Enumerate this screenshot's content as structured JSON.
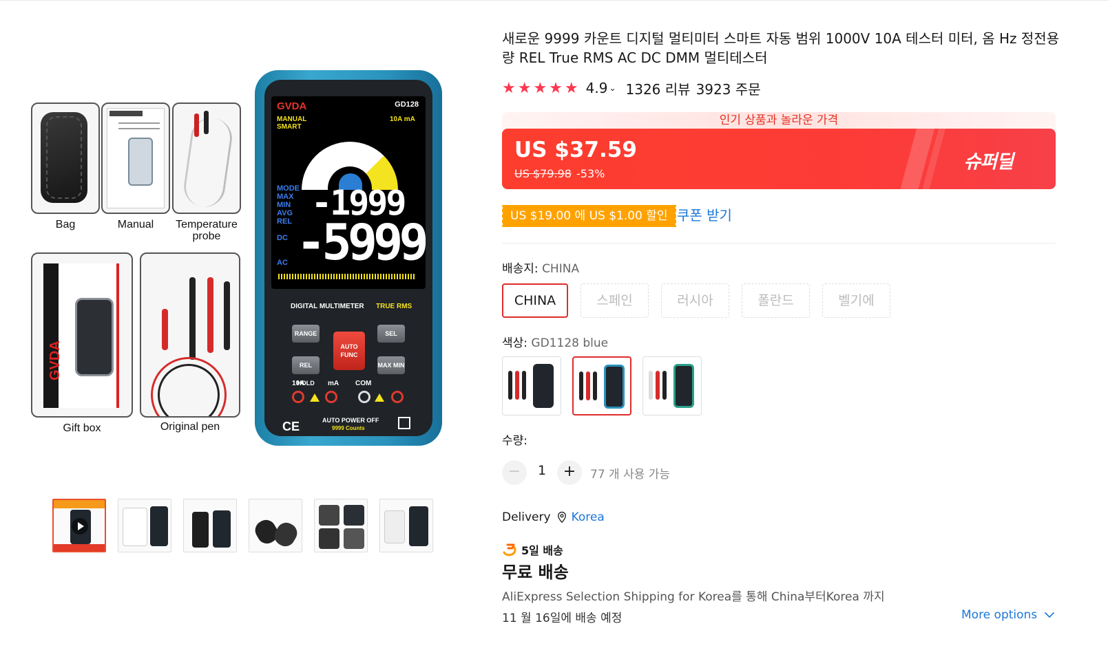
{
  "gallery": {
    "accessories": [
      {
        "label": "Bag"
      },
      {
        "label": "Manual"
      },
      {
        "label": "Temperature probe"
      },
      {
        "label": "Gift box"
      },
      {
        "label": "Original pen"
      }
    ],
    "device": {
      "brand": "GVDA",
      "model": "GD128",
      "mode_text": "MANUAL SMART",
      "range_text": "10A mA",
      "reading_top": "-1999",
      "reading_main": "-5999",
      "panel_title": "DIGITAL MULTIMETER",
      "panel_trms": "TRUE RMS",
      "keys": [
        "RANGE",
        "SEL",
        "REL HOLD",
        "MAX MIN",
        "AUTO FUNC"
      ],
      "jacks": [
        "10A",
        "mA",
        "COM"
      ],
      "bottom_text": "AUTO POWER OFF",
      "counts_text": "9999 Counts"
    },
    "thumbnails": 6,
    "active_thumbnail": 0
  },
  "product": {
    "title": "새로운 9999 카운트 디지털 멀티미터 스마트 자동 범위 1000V 10A 테스터 미터, 옴 Hz 정전용량 REL True RMS AC DC DMM 멀티테스터",
    "stars": "★★★★★",
    "rating": "4.9",
    "reviews": "1326 리뷰",
    "orders": "3923 주문",
    "promo_banner": "인기 상품과 놀라운 가격",
    "price_current": "US $37.59",
    "price_original": "US $79.98",
    "discount": "-53%",
    "superdeal_label": "슈퍼딜",
    "coupon_text": "US $19.00 에 US $1.00 할인",
    "coupon_link": "쿠폰 받기"
  },
  "options": {
    "ship_from_label": "배송지:",
    "ship_from_value": "CHINA",
    "ship_from": [
      {
        "label": "CHINA",
        "state": "selected"
      },
      {
        "label": "스페인",
        "state": "disabled"
      },
      {
        "label": "러시아",
        "state": "disabled"
      },
      {
        "label": "폴란드",
        "state": "disabled"
      },
      {
        "label": "벨기에",
        "state": "disabled"
      }
    ],
    "color_label": "색상:",
    "color_value": "GD1128 blue",
    "color_selected_index": 1,
    "quantity_label": "수량:",
    "quantity_value": "1",
    "quantity_minus": "−",
    "quantity_plus": "+",
    "quantity_available": "77 개 사용 가능"
  },
  "delivery": {
    "label": "Delivery",
    "location": "Korea",
    "days_badge": "5일 배송",
    "free_shipping": "무료 배송",
    "description": "AliExpress Selection Shipping for Korea를 통해 China부터Korea 까지",
    "date": "11 월 16일에 배송 예정",
    "more_options": "More options"
  },
  "colors": {
    "accent_red": "#fd3d2e",
    "price_red": "#fd384f",
    "coupon_orange": "#ffa200",
    "link_blue": "#1b77d8",
    "device_blue": "#2a93bd"
  }
}
